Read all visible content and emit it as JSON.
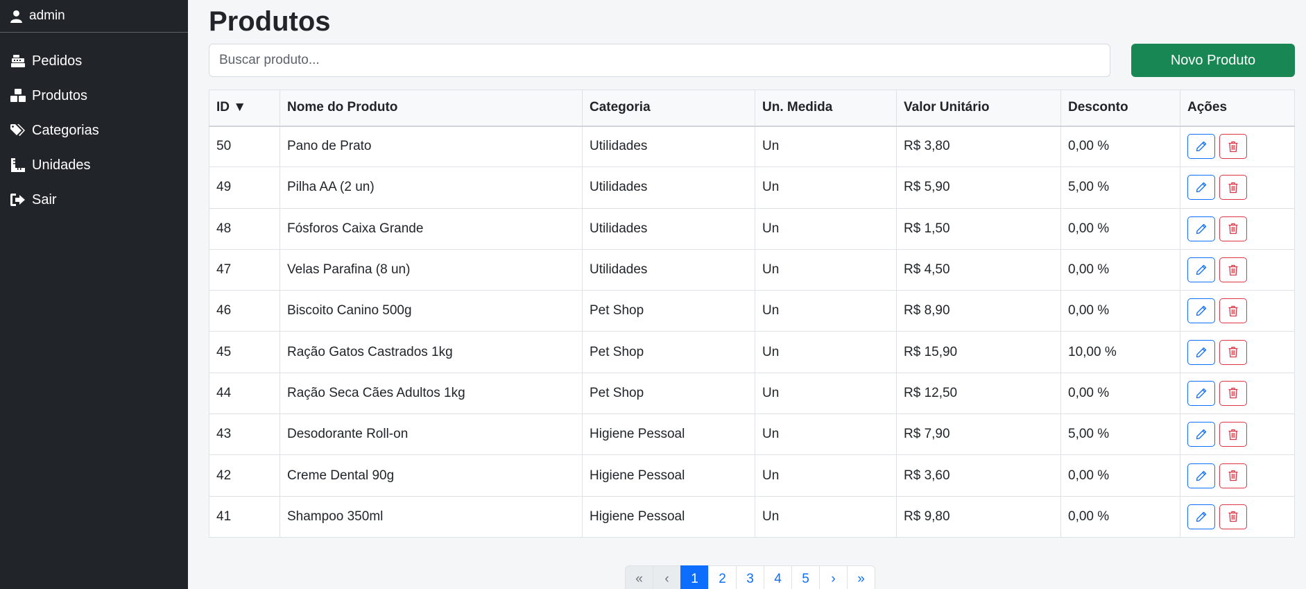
{
  "sidebar": {
    "user": "admin",
    "items": [
      {
        "label": "Pedidos",
        "icon": "cash-register-icon"
      },
      {
        "label": "Produtos",
        "icon": "boxes-icon"
      },
      {
        "label": "Categorias",
        "icon": "tags-icon"
      },
      {
        "label": "Unidades",
        "icon": "ruler-icon"
      },
      {
        "label": "Sair",
        "icon": "sign-out-icon"
      }
    ]
  },
  "page": {
    "title": "Produtos",
    "search_placeholder": "Buscar produto...",
    "new_button": "Novo Produto"
  },
  "table": {
    "headers": [
      "ID ▼",
      "Nome do Produto",
      "Categoria",
      "Un. Medida",
      "Valor Unitário",
      "Desconto",
      "Ações"
    ],
    "rows": [
      [
        "50",
        "Pano de Prato",
        "Utilidades",
        "Un",
        "R$ 3,80",
        "0,00 %"
      ],
      [
        "49",
        "Pilha AA (2 un)",
        "Utilidades",
        "Un",
        "R$ 5,90",
        "5,00 %"
      ],
      [
        "48",
        "Fósforos Caixa Grande",
        "Utilidades",
        "Un",
        "R$ 1,50",
        "0,00 %"
      ],
      [
        "47",
        "Velas Parafina (8 un)",
        "Utilidades",
        "Un",
        "R$ 4,50",
        "0,00 %"
      ],
      [
        "46",
        "Biscoito Canino 500g",
        "Pet Shop",
        "Un",
        "R$ 8,90",
        "0,00 %"
      ],
      [
        "45",
        "Ração Gatos Castrados 1kg",
        "Pet Shop",
        "Un",
        "R$ 15,90",
        "10,00 %"
      ],
      [
        "44",
        "Ração Seca Cães Adultos 1kg",
        "Pet Shop",
        "Un",
        "R$ 12,50",
        "0,00 %"
      ],
      [
        "43",
        "Desodorante Roll-on",
        "Higiene Pessoal",
        "Un",
        "R$ 7,90",
        "5,00 %"
      ],
      [
        "42",
        "Creme Dental 90g",
        "Higiene Pessoal",
        "Un",
        "R$ 3,60",
        "0,00 %"
      ],
      [
        "41",
        "Shampoo 350ml",
        "Higiene Pessoal",
        "Un",
        "R$ 9,80",
        "0,00 %"
      ]
    ]
  },
  "pagination": {
    "first": "«",
    "prev": "‹",
    "pages": [
      "1",
      "2",
      "3",
      "4",
      "5"
    ],
    "active": "1",
    "next": "›",
    "last": "»"
  },
  "colors": {
    "sidebar_bg": "#212529",
    "primary": "#0d6efd",
    "success": "#198754",
    "danger": "#dc3545"
  }
}
